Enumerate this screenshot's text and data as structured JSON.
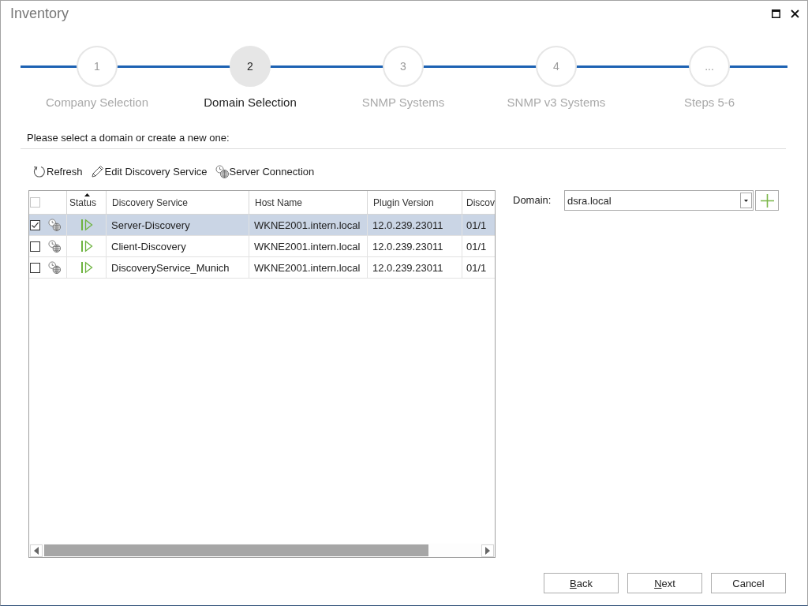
{
  "window": {
    "title": "Inventory"
  },
  "steps": [
    {
      "number": "1",
      "label": "Company Selection",
      "selected": false
    },
    {
      "number": "2",
      "label": "Domain Selection",
      "selected": true
    },
    {
      "number": "3",
      "label": "SNMP Systems",
      "selected": false
    },
    {
      "number": "4",
      "label": "SNMP v3 Systems",
      "selected": false
    },
    {
      "number": "...",
      "label": "Steps 5-6",
      "selected": false
    }
  ],
  "instruction": "Please select a domain or create a new one:",
  "toolbar": [
    {
      "kind": "refresh",
      "label": "Refresh"
    },
    {
      "kind": "edit",
      "label": "Edit Discovery Service"
    },
    {
      "kind": "connection",
      "label": "Server Connection"
    }
  ],
  "table": {
    "header_checkbox": {
      "checked": false
    },
    "status_column": {
      "label": "Status",
      "sorted": true
    },
    "columns": [
      {
        "label": "Discovery Service",
        "sorted": false
      },
      {
        "label": "Host Name",
        "sorted": false
      },
      {
        "label": "Plugin Version",
        "sorted": false
      },
      {
        "label": "Discov",
        "sorted": false
      }
    ],
    "rows": [
      {
        "checked": true,
        "selected": true,
        "running": true,
        "cells": [
          "Server-Discovery",
          "WKNE2001.intern.local",
          "12.0.239.23011",
          "01/1"
        ]
      },
      {
        "checked": false,
        "selected": false,
        "running": true,
        "cells": [
          "Client-Discovery",
          "WKNE2001.intern.local",
          "12.0.239.23011",
          "01/1"
        ]
      },
      {
        "checked": false,
        "selected": false,
        "running": true,
        "cells": [
          "DiscoveryService_Munich",
          "WKNE2001.intern.local",
          "12.0.239.23011",
          "01/1"
        ]
      }
    ]
  },
  "domain": {
    "label": "Domain:",
    "value": "dsra.local"
  },
  "buttons": [
    {
      "label": "Back",
      "access_key": true
    },
    {
      "label": "Next",
      "access_key": true
    },
    {
      "label": "Cancel",
      "access_key": false
    }
  ]
}
